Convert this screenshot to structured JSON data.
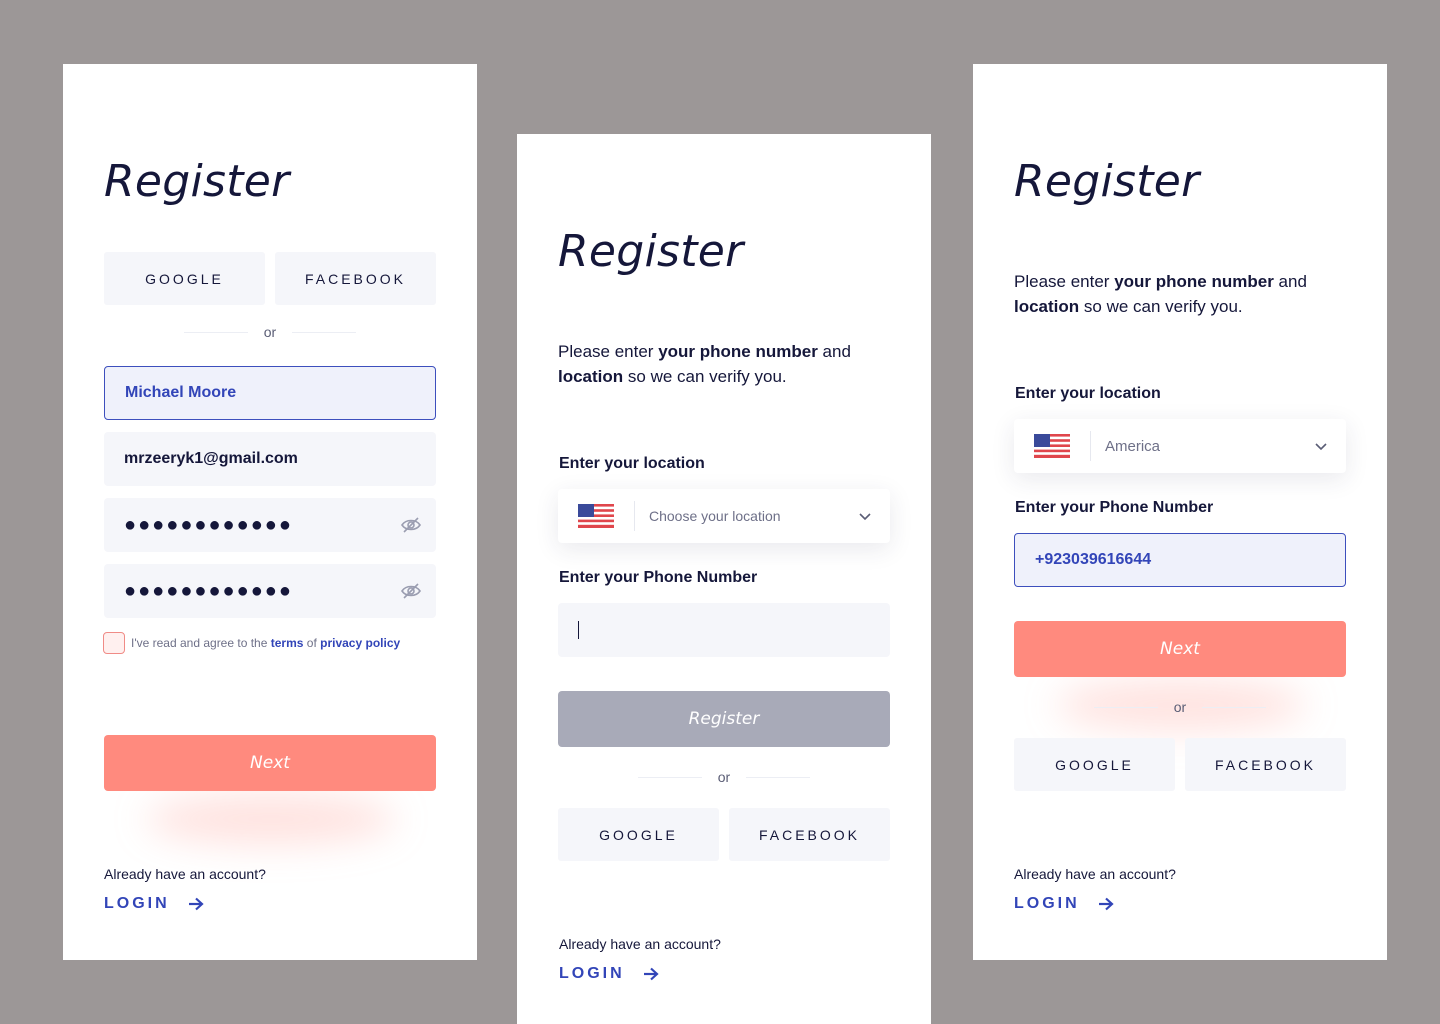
{
  "screens": [
    {
      "title": "Register",
      "social": {
        "google": "GOOGLE",
        "facebook": "FACEBOOK"
      },
      "or": "or",
      "fields": {
        "name": "Michael Moore",
        "email": "mrzeeryk1@gmail.com",
        "password": "●●●●●●●●●●●●",
        "confirm_password": "●●●●●●●●●●●●"
      },
      "agree": {
        "prefix": "I've read and agree to the",
        "terms": "terms",
        "of": "of",
        "privacy": "privacy policy"
      },
      "next": "Next",
      "already": "Already have an account?",
      "login": "LOGIN"
    },
    {
      "title": "Register",
      "desc": {
        "part1": "Please enter",
        "bold1": "your phone number",
        "part2": "and",
        "bold2": "location",
        "part3": "so we can verify you."
      },
      "location_label": "Enter your location",
      "location_placeholder": "Choose your location",
      "phone_label": "Enter your Phone Number",
      "register": "Register",
      "or": "or",
      "social": {
        "google": "GOOGLE",
        "facebook": "FACEBOOK"
      },
      "already": "Already have an account?",
      "login": "LOGIN"
    },
    {
      "title": "Register",
      "desc": {
        "part1": "Please enter",
        "bold1": "your phone number",
        "part2": "and",
        "bold2": "location",
        "part3": "so we can verify you."
      },
      "location_label": "Enter your location",
      "location_value": "America",
      "phone_label": "Enter your Phone Number",
      "phone_value": "+923039616644",
      "next": "Next",
      "or": "or",
      "social": {
        "google": "GOOGLE",
        "facebook": "FACEBOOK"
      },
      "already": "Already have an account?",
      "login": "LOGIN"
    }
  ],
  "colors": {
    "background": "#9c9797",
    "accent": "#3245b8",
    "coral": "#ff8a7e",
    "disabled": "#a8aab8",
    "field": "#f5f6fa",
    "text": "#15173a"
  }
}
